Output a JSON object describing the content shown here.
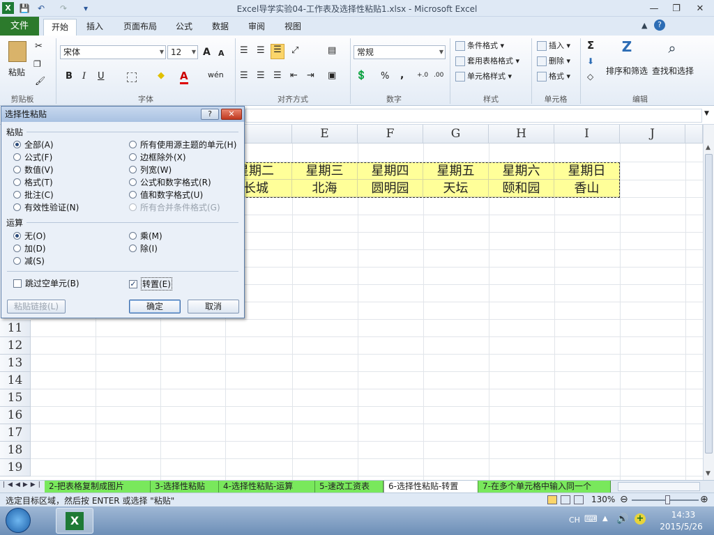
{
  "window": {
    "title": "Excel导学实验04-工作表及选择性粘贴1.xlsx - Microsoft Excel",
    "qat": {
      "save": "💾",
      "undo": "↶",
      "redo": "↷",
      "customize": "▾"
    },
    "controls": {
      "minimize": "—",
      "maximize": "❐",
      "close": "✕"
    }
  },
  "tabs": [
    {
      "label": "文件"
    },
    {
      "label": "开始"
    },
    {
      "label": "插入"
    },
    {
      "label": "页面布局"
    },
    {
      "label": "公式"
    },
    {
      "label": "数据"
    },
    {
      "label": "审阅"
    },
    {
      "label": "视图"
    }
  ],
  "ribbon": {
    "clipboard": {
      "label": "剪贴板",
      "paste": "粘贴"
    },
    "font": {
      "label": "字体",
      "name": "宋体",
      "size": "12",
      "bold": "B",
      "italic": "I",
      "underline": "U",
      "grow": "A",
      "shrink": "A",
      "fill": "◆",
      "color": "A",
      "wen": "wén"
    },
    "alignment": {
      "label": "对齐方式"
    },
    "number": {
      "label": "数字",
      "format": "常规",
      "percent": "%",
      "comma": ","
    },
    "styles": {
      "label": "样式",
      "conditional": "条件格式",
      "table": "套用表格格式",
      "cell": "单元格样式"
    },
    "cells": {
      "label": "单元格",
      "insert": "插入",
      "delete": "删除",
      "format": "格式"
    },
    "editing": {
      "label": "编辑",
      "sigma": "Σ",
      "sort": "排序和筛选",
      "find": "查找和选择"
    }
  },
  "sheet": {
    "columns": [
      "D",
      "E",
      "F",
      "G",
      "H",
      "I",
      "J"
    ],
    "rows": [
      "11",
      "12",
      "13",
      "14",
      "15",
      "16",
      "17",
      "18",
      "19"
    ],
    "row1": [
      "星期二",
      "星期三",
      "星期四",
      "星期五",
      "星期六",
      "星期日"
    ],
    "row2": [
      "长城",
      "北海",
      "圆明园",
      "天坛",
      "颐和园",
      "香山"
    ]
  },
  "sheet_tabs": [
    {
      "label": "2-把表格复制成图片"
    },
    {
      "label": "3-选择性粘贴"
    },
    {
      "label": "4-选择性粘贴-运算"
    },
    {
      "label": "5-速改工资表"
    },
    {
      "label": "6-选择性粘贴-转置"
    },
    {
      "label": "7-在多个单元格中输入同一个"
    }
  ],
  "status": {
    "message": "选定目标区域，然后按 ENTER 或选择 \"粘贴\"",
    "zoom": "130%"
  },
  "taskbar": {
    "ime": "CH",
    "time": "14:33",
    "date": "2015/5/26"
  },
  "dialog": {
    "title": "选择性粘贴",
    "help": "?",
    "close": "✕",
    "paste_section": "粘贴",
    "paste_options_left": [
      "全部(A)",
      "公式(F)",
      "数值(V)",
      "格式(T)",
      "批注(C)",
      "有效性验证(N)"
    ],
    "paste_options_right": [
      "所有使用源主题的单元(H)",
      "边框除外(X)",
      "列宽(W)",
      "公式和数字格式(R)",
      "值和数字格式(U)",
      "所有合并条件格式(G)"
    ],
    "operation_section": "运算",
    "operation_left": [
      "无(O)",
      "加(D)",
      "减(S)"
    ],
    "operation_right": [
      "乘(M)",
      "除(I)"
    ],
    "skip_blanks": "跳过空单元(B)",
    "transpose": "转置(E)",
    "paste_link": "粘贴链接(L)",
    "ok": "确定",
    "cancel": "取消"
  }
}
